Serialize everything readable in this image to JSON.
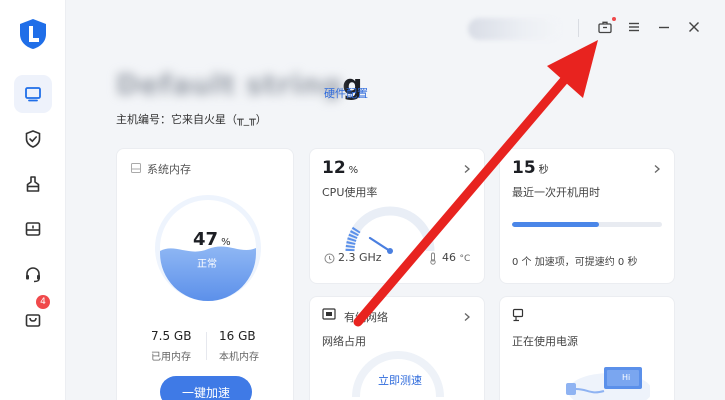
{
  "sidebar": {
    "items": [
      {
        "name": "monitor-icon",
        "active": true
      },
      {
        "name": "shield-icon",
        "active": false
      },
      {
        "name": "broom-icon",
        "active": false
      },
      {
        "name": "toolbox-icon",
        "active": false
      },
      {
        "name": "headset-icon",
        "active": false
      },
      {
        "name": "bag-icon",
        "active": false,
        "badge": "4"
      }
    ]
  },
  "header": {
    "device_name_blurred": "Default string",
    "device_name_suffix": "g",
    "hardware_link": "硬件配置",
    "host_id": "主机编号：它来自火星（╥_╥）"
  },
  "memory": {
    "title": "系统内存",
    "percent": "47",
    "percent_unit": "%",
    "status": "正常",
    "used_value": "7.5 GB",
    "used_label": "已用内存",
    "total_value": "16 GB",
    "total_label": "本机内存",
    "button_label": "一键加速"
  },
  "cpu": {
    "value": "12",
    "unit": "%",
    "label": "CPU使用率",
    "freq": "2.3 GHz",
    "temp": "46",
    "temp_unit": "°C"
  },
  "boot": {
    "value": "15",
    "unit": "秒",
    "label": "最近一次开机用时",
    "progress": 0.58,
    "note": "0 个 加速项，可提速约 0 秒"
  },
  "network": {
    "title": "有线网络",
    "label": "网络占用",
    "action": "立即测速"
  },
  "power": {
    "label": "正在使用电源",
    "screen_text": "Hi"
  },
  "colors": {
    "accent": "#3f7ae6",
    "arrow": "#e8231f"
  }
}
